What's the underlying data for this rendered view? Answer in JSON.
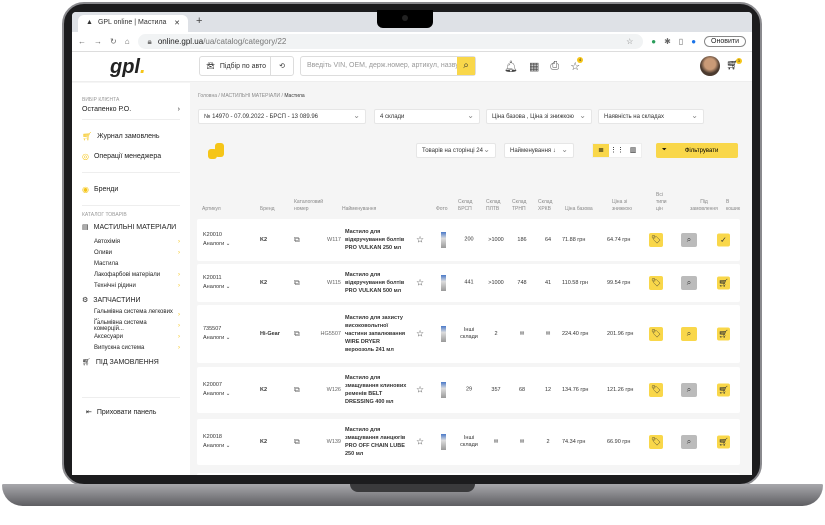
{
  "browser": {
    "tab_title": "GPL online | Мастила",
    "url_host": "online.gpl.ua",
    "url_path": "/ua/catalog/category/22",
    "update_label": "Оновити"
  },
  "header": {
    "logo": "gpl",
    "pick_by_car": "Підбір по авто",
    "search_placeholder": "Введіть VIN, OEM, держ.номер, артикул, назву",
    "favorites_badge": "4",
    "cart_badge": "3"
  },
  "sidebar": {
    "client_label": "ВИБІР КЛІЄНТА",
    "client_name": "Остапенко Р.О.",
    "orders_journal": "Журнал замовлень",
    "manager_ops": "Операції менеджера",
    "brands": "Бренди",
    "catalog_label": "КАТАЛОГ ТОВАРІВ",
    "cat1": "МАСТИЛЬНІ МАТЕРІАЛИ",
    "cat1_items": [
      "Автохімія",
      "Оливи",
      "Мастила",
      "Лакофарбові матеріали",
      "Технічні рідини"
    ],
    "cat2": "ЗАПЧАСТИНИ",
    "cat2_items": [
      "Гальмівна система легкових ...",
      "Гальмівна система комерцій...",
      "Аксесуари",
      "Випускна система"
    ],
    "cat3": "ПІД ЗАМОВЛЕННЯ",
    "hide_panel": "Приховати панель"
  },
  "breadcrumb": [
    "Головна",
    "МАСТИЛЬНІ МАТЕРІАЛИ",
    "Мастила"
  ],
  "filters": {
    "order": "№ 14970 - 07.09.2022 - БРСП - 13 089.96",
    "warehouses": "4 склади",
    "prices": "Ціна базова , Ціна зі знижкою",
    "availability": "Наявність на складах"
  },
  "toolbar": {
    "per_page": "Товарів на сторінці  24",
    "sort": "Найменування ↓",
    "filter_button": "Фільтрувати"
  },
  "columns": [
    "Артикул",
    "Бренд",
    "Каталоговий номер",
    "Найменування",
    "Фото",
    "Склад БРСП",
    "Склад ПЛТВ",
    "Склад ТРНП",
    "Склад ХРКВ",
    "Ціна базова",
    "Ціна зі знижкою",
    "Всі типи цін",
    "Під замовлення",
    "В кошик"
  ],
  "analogs_label": "Аналоги",
  "rows": [
    {
      "article": "K20010",
      "brand": "K2",
      "catnum": "W117",
      "name": "Мастило для відкручування болтів PRO VULKAN 250 мл",
      "brsp": "200",
      "pltv": ">1000",
      "trnp": "186",
      "hrkv": "64",
      "base": "71.88 грн",
      "disc": "64.74 грн"
    },
    {
      "article": "K20011",
      "brand": "K2",
      "catnum": "W115",
      "name": "Мастило для відкручування болтів PRO VULKAN 500 мл",
      "brsp": "441",
      "pltv": ">1000",
      "trnp": "748",
      "hrkv": "41",
      "base": "110.58 грн",
      "disc": "99.54 грн"
    },
    {
      "article": "735507",
      "brand": "Hi-Gear",
      "catnum": "HG5507",
      "name": "Мастило для захисту високовольтної частини запалювання WIRE DRYER вероозоль 241 мл",
      "brsp": "Інші склади",
      "pltv": "2",
      "trnp": "✉",
      "hrkv": "✉",
      "base": "224.40 грн",
      "disc": "201.96 грн"
    },
    {
      "article": "K20007",
      "brand": "K2",
      "catnum": "W126",
      "name": "Мастило для змащування клинових ременів BELT DRESSING 400 мл",
      "brsp": "29",
      "pltv": "357",
      "trnp": "68",
      "hrkv": "12",
      "base": "134.76 грн",
      "disc": "121.26 грн"
    },
    {
      "article": "K20018",
      "brand": "K2",
      "catnum": "W139",
      "name": "Мастило для змащування ланцюгів PRO OFF CHAIN LUBE 250 мл",
      "brsp": "Інші склади",
      "pltv": "✉",
      "trnp": "✉",
      "hrkv": "2",
      "base": "74.34 грн",
      "disc": "66.90 грн"
    }
  ]
}
